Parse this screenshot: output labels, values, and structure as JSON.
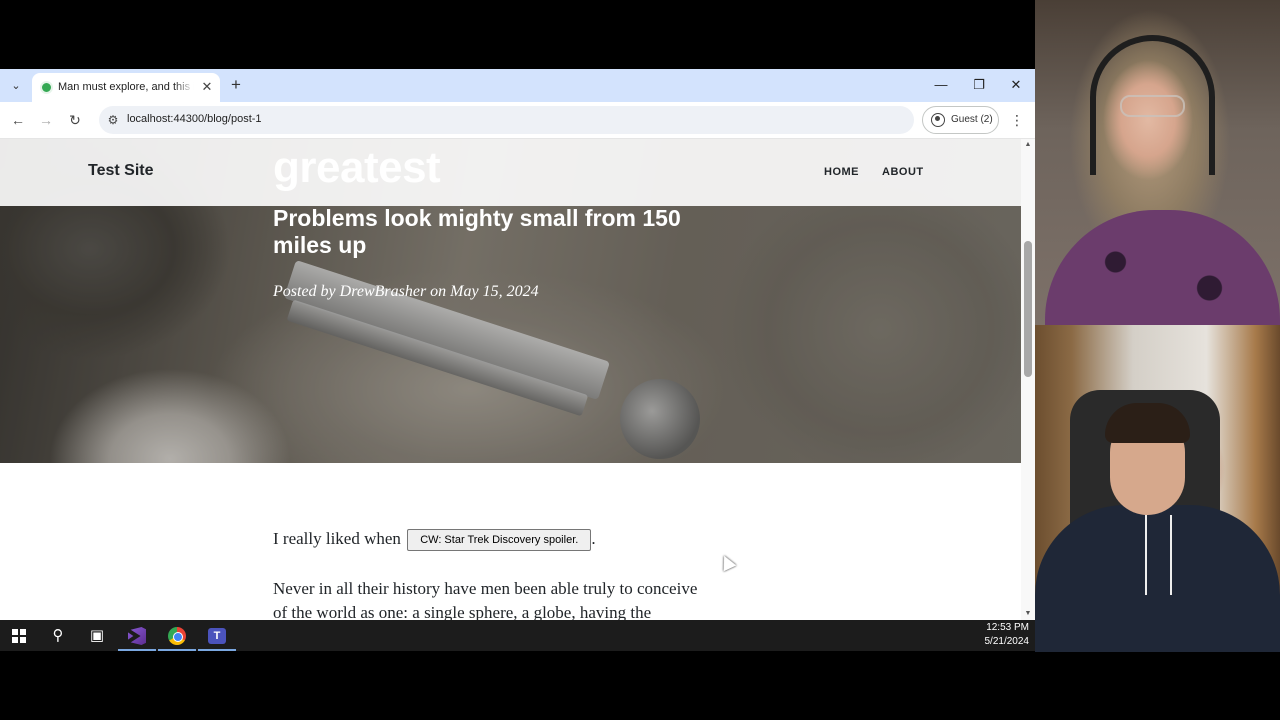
{
  "browser": {
    "tab": {
      "title": "Man must explore, and this is e",
      "close": "✕"
    },
    "new_tab": "+",
    "controls": {
      "minimize": "—",
      "restore": "❐",
      "close": "✕"
    },
    "nav": {
      "back": "←",
      "forward": "→",
      "reload": "↻"
    },
    "url": "localhost:44300/blog/post-1",
    "profile_label": "Guest (2)",
    "menu": "⋮"
  },
  "site": {
    "brand": "Test Site",
    "nav": [
      "HOME",
      "ABOUT"
    ],
    "heading_fragment": "greatest",
    "subheading": "Problems look mighty small from 150 miles up",
    "meta": "Posted by DrewBrasher on May 15, 2024",
    "paragraph1_prefix": "I really liked when",
    "spoiler_button": "CW: Star Trek Discovery spoiler.",
    "paragraph1_suffix": ".",
    "paragraph2_line1": "Never in all their history have men been able truly to conceive",
    "paragraph2_line2": "of the world as one: a single sphere, a globe, having the"
  },
  "taskbar": {
    "time": "12:53 PM",
    "date": "5/21/2024",
    "apps": [
      "start-icon",
      "search-icon",
      "task-view-icon",
      "visual-studio-icon",
      "chrome-icon",
      "teams-icon"
    ]
  },
  "colors": {
    "tabstrip": "#d3e3fd",
    "taskbar": "#1c1c1c",
    "accent": "#7aa7e0"
  }
}
